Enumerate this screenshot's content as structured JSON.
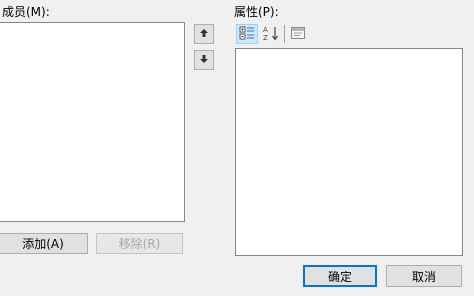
{
  "members": {
    "label": "成员(M):",
    "add_label": "添加(A)",
    "remove_label": "移除(R)"
  },
  "properties": {
    "label": "属性(P):"
  },
  "footer": {
    "ok_label": "确定",
    "cancel_label": "取消"
  },
  "icons": {
    "move_up": "arrow-up-icon",
    "move_down": "arrow-down-icon",
    "categorized": "categorized-icon",
    "alphabetical": "sort-alphabetical-icon",
    "property_pages": "property-pages-icon"
  }
}
